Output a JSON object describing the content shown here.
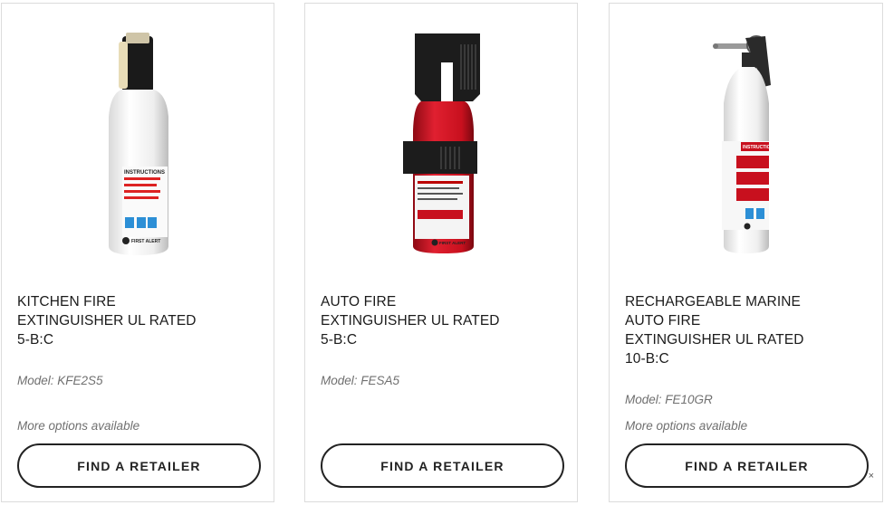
{
  "products": [
    {
      "name_lines": [
        "KITCHEN FIRE",
        "EXTINGUISHER UL RATED",
        "5-B:C"
      ],
      "model": "Model: KFE2S5",
      "more_options": "More options available",
      "button": "FIND A RETAILER",
      "image_label": "INSTRUCTIONS",
      "brand": "FIRST ALERT",
      "body_color": "#f2f2f2"
    },
    {
      "name_lines": [
        "AUTO FIRE",
        "EXTINGUISHER UL RATED",
        "5-B:C"
      ],
      "model": "Model: FESA5",
      "button": "FIND A RETAILER",
      "body_color": "#c8101e"
    },
    {
      "name_lines": [
        "RECHARGEABLE MARINE",
        "AUTO FIRE",
        "EXTINGUISHER UL RATED",
        "10-B:C"
      ],
      "model": "Model: FE10GR",
      "more_options": "More options available",
      "button": "FIND A RETAILER",
      "image_label": "INSTRUCTION",
      "body_color": "#f2f2f2"
    }
  ],
  "close_symbol": "×"
}
